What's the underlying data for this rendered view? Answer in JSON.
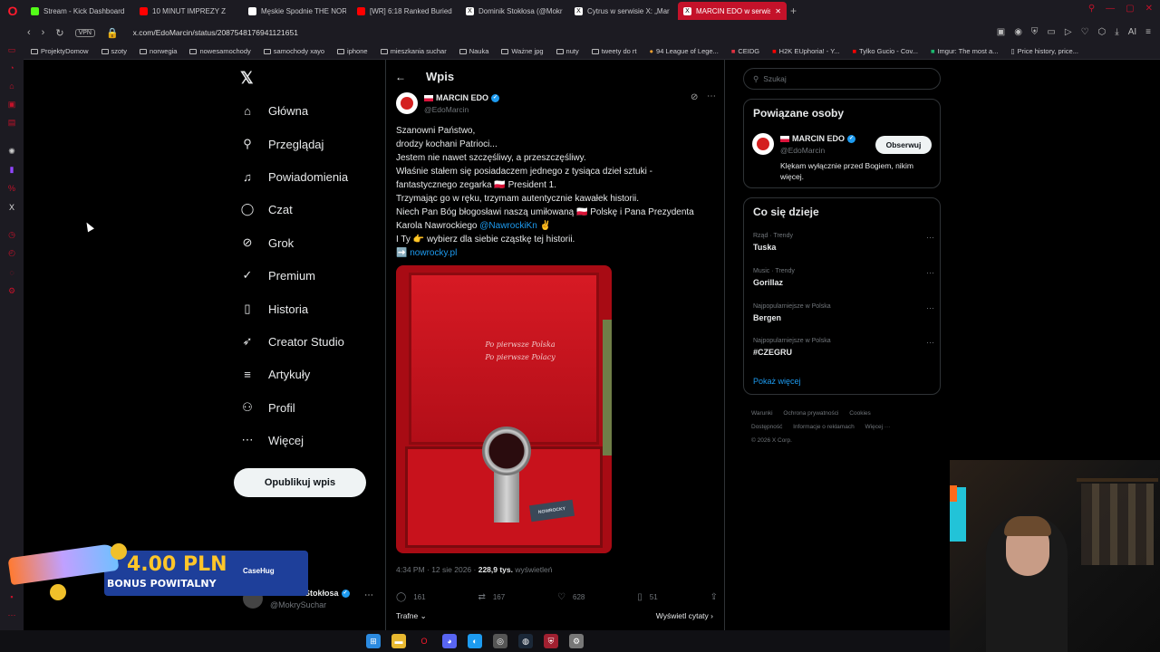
{
  "browser": {
    "tabs": [
      {
        "title": "Stream - Kick Dashboard",
        "color": "#53fc18"
      },
      {
        "title": "10 MINUT IMPREZY Z",
        "color": "#ff0000"
      },
      {
        "title": "Męskie Spodnie THE NOR",
        "color": "#ffffff"
      },
      {
        "title": "[WR] 6:18 Ranked Buried",
        "color": "#ff0000"
      },
      {
        "title": "Dominik Stokłosa (@Mokr",
        "color": "#000000"
      },
      {
        "title": "Cytrus w serwisie X: „Mar",
        "color": "#000000"
      },
      {
        "title": "MARCIN EDO w serwisie",
        "color": "#000000"
      }
    ],
    "new_tab": "+",
    "vpn": "VPN",
    "url": "x.com/EdoMarcin/status/2087548176941121651",
    "bookmarks": [
      "ProjektyDomow",
      "szoty",
      "norwegia",
      "nowesamochody",
      "samochody xayo",
      "iphone",
      "mieszkania suchar",
      "Nauka",
      "Ważne jpg",
      "nuty",
      "tweety do rt",
      "94 League of Lege...",
      "CEIDG",
      "H2K EUphoria! - Y...",
      "Tylko Gucio - Cov...",
      "Imgur: The most a...",
      "Price history, price..."
    ],
    "ai_label": "AI"
  },
  "nav": {
    "items": [
      {
        "label": "Główna",
        "icon": "home-icon",
        "glyph": "⌂"
      },
      {
        "label": "Przeglądaj",
        "icon": "search-icon",
        "glyph": "⚲"
      },
      {
        "label": "Powiadomienia",
        "icon": "bell-icon",
        "glyph": "🔔"
      },
      {
        "label": "Czat",
        "icon": "chat-icon",
        "glyph": "◯"
      },
      {
        "label": "Grok",
        "icon": "grok-icon",
        "glyph": "⊘"
      },
      {
        "label": "Premium",
        "icon": "premium-icon",
        "glyph": "✓"
      },
      {
        "label": "Historia",
        "icon": "bookmark-icon",
        "glyph": "▯"
      },
      {
        "label": "Creator Studio",
        "icon": "rocket-icon",
        "glyph": "➶"
      },
      {
        "label": "Artykuły",
        "icon": "article-icon",
        "glyph": "≡"
      },
      {
        "label": "Profil",
        "icon": "profile-icon",
        "glyph": "⚇"
      },
      {
        "label": "Więcej",
        "icon": "more-icon",
        "glyph": "⋯"
      }
    ],
    "post_button": "Opublikuj wpis",
    "account_name": "Dominik Stokłosa",
    "account_handle": "@MokrySuchar"
  },
  "main": {
    "header": "Wpis",
    "tweet": {
      "author": "MARCIN EDO",
      "handle": "@EdoMarcin",
      "lines": [
        "Szanowni Państwo,",
        "drodzy kochani Patrioci...",
        "Jestem nie nawet szczęśliwy, a przeszczęśliwy.",
        "Właśnie stałem się posiadaczem jednego z tysiąca dzieł sztuki -",
        "fantastycznego zegarka 🇵🇱 President 1.",
        "Trzymając go w ręku, trzymam autentycznie kawałek historii.",
        "Niech Pan Bóg błogosławi naszą umiłowaną 🇵🇱 Polskę i Pana Prezydenta"
      ],
      "line8_prefix": "Karola Nawrockiego ",
      "line8_mention": "@NawrockiKn",
      "line8_suffix": " ✌",
      "line9": "I Ty 👉 wybierz dla siebie cząstkę tej historii.",
      "link_prefix": "➡️ ",
      "link": "nowrocky.pl",
      "image_lid_line1": "Po pierwsze Polska",
      "image_lid_line2": "Po pierwsze Polacy",
      "image_tag": "NOWROCKY",
      "time": "4:34 PM · 12 sie 2026 · ",
      "views_count": "228,9 tys.",
      "views_label": " wyświetleń",
      "replies": "161",
      "reposts": "167",
      "likes": "628",
      "bookmarks": "51",
      "sort": "Trafne ⌄",
      "quotes": "Wyświetl cytaty ›"
    }
  },
  "right": {
    "search_placeholder": "Szukaj",
    "related_title": "Powiązane osoby",
    "related_name": "MARCIN EDO",
    "related_handle": "@EdoMarcin",
    "follow": "Obserwuj",
    "related_bio": "Klękam wyłącznie przed Bogiem, nikim więcej.",
    "trends_title": "Co się dzieje",
    "trends": [
      {
        "category": "Rząd · Trendy",
        "name": "Tuska"
      },
      {
        "category": "Music · Trendy",
        "name": "Gorillaz"
      },
      {
        "category": "Najpopularniejsze w Polska",
        "name": "Bergen"
      },
      {
        "category": "Najpopularniejsze w Polska",
        "name": "#CZEGRU"
      }
    ],
    "show_more": "Pokaż więcej",
    "footer_line1": [
      "Warunki",
      "Ochrona prywatności",
      "Cookies"
    ],
    "footer_line2": [
      "Dostępność",
      "Informacje o reklamach",
      "Więcej ···"
    ],
    "copyright": "© 2026 X Corp."
  },
  "promo": {
    "amount": "4.00 PLN",
    "subtitle": "BONUS POWITALNY",
    "brand": "CaseHug"
  }
}
